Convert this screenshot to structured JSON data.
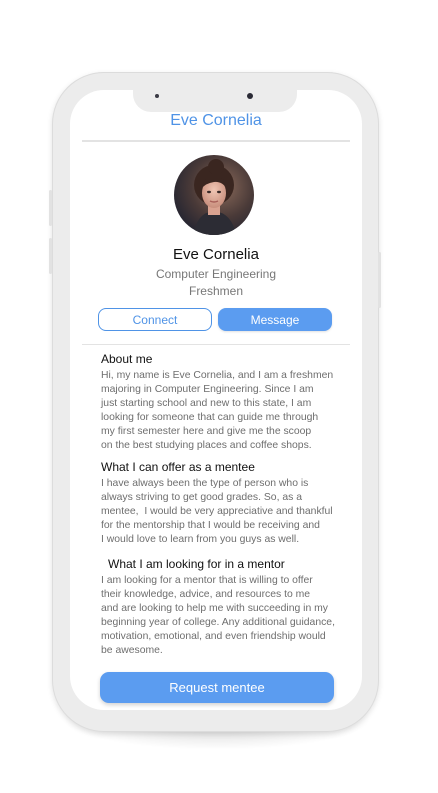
{
  "header": {
    "title": "Eve Cornelia"
  },
  "profile": {
    "name": "Eve Cornelia",
    "major": "Computer Engineering",
    "year": "Freshmen"
  },
  "actions": {
    "connect_label": "Connect",
    "message_label": "Message"
  },
  "sections": {
    "about": {
      "heading": "About me",
      "lines": [
        "Hi, my name is Eve Cornelia, and I am a freshmen",
        "majoring in Computer Engineering. Since I am",
        "just starting school and new to this state, I am",
        "looking for someone that can guide me through",
        "my first semester here and give me the scoop",
        "on the best studying places and coffee shops."
      ]
    },
    "offer": {
      "heading": "What I can offer as a mentee",
      "lines": [
        "I have always been the type of person who is",
        "always striving to get good grades. So, as a",
        "mentee,  I would be very appreciative and thankful",
        "for the mentorship that I would be receiving and",
        "I would love to learn from you guys as well."
      ]
    },
    "looking": {
      "heading": "What I am looking for in a mentor",
      "lines": [
        "I am looking for a mentor that is willing to offer",
        "their knowledge, advice, and resources to me",
        "and are looking to help me with succeeding in my",
        "beginning year of college. Any additional guidance,",
        "motivation, emotional, and even friendship would",
        "be awesome."
      ]
    }
  },
  "footer": {
    "request_label": "Request mentee"
  },
  "colors": {
    "accent": "#5b9cf0",
    "accent_text": "#4f93e6",
    "frame": "#ececec"
  }
}
